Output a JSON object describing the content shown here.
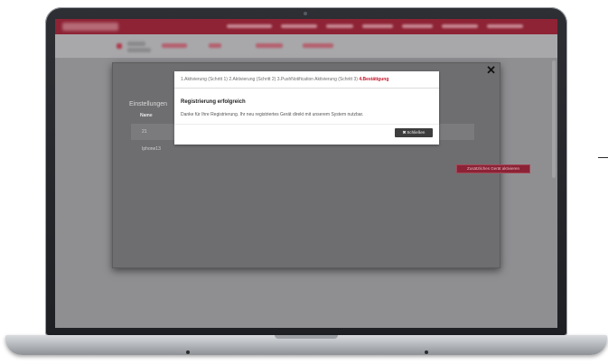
{
  "wizard": {
    "steps": [
      {
        "label": "1.Aktivierung (Schritt 1)"
      },
      {
        "label": "2.Aktivierung (Schritt 2)"
      },
      {
        "label": "3.PushNotification Aktivierung (Schritt 3)"
      },
      {
        "label": "4.Bestätigung",
        "active": true
      }
    ],
    "title": "Registrierung erfolgreich",
    "message": "Danke für Ihre Registrierung. Ihr neu registriertes Gerät direkt mit unserem System nutzbar.",
    "close_label": "Schließen"
  },
  "background_dialog": {
    "heading": "Einstellungen",
    "table_header": "Name",
    "rows": [
      {
        "name": "21"
      },
      {
        "name": "Iphone13"
      }
    ],
    "add_button_label": "Zusätzliches Gerät aktivieren",
    "close_glyph": "✕"
  },
  "colors": {
    "brand": "#8d2335",
    "active_step": "#c4172c",
    "close_button": "#3d3d3d"
  }
}
